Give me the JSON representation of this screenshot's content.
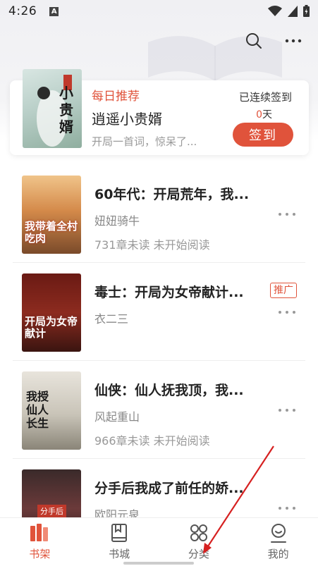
{
  "status_bar": {
    "time": "4:26",
    "notification_letter": "A"
  },
  "header": {
    "search_icon": "search-icon",
    "more_icon": "more-horizontal-icon"
  },
  "recommend": {
    "tag": "每日推荐",
    "title": "逍遥小贵婿",
    "desc": "开局一首词，惊呆了...",
    "sign_label": "已连续签到",
    "sign_days": "0",
    "sign_days_unit": "天",
    "sign_button": "签到",
    "cover_text": "小贵婿"
  },
  "books": [
    {
      "title": "60年代：开局荒年，我...",
      "author": "妞妞骑牛",
      "status": "731章未读 未开始阅读",
      "cover_text": "我带着全村吃肉",
      "ad": ""
    },
    {
      "title": "毒士：开局为女帝献计...",
      "author": "衣二三",
      "status": "",
      "cover_text": "开局为女帝献计",
      "ad": "推广"
    },
    {
      "title": "仙侠：仙人抚我顶，我...",
      "author": "风起重山",
      "status": "966章未读 未开始阅读",
      "cover_text": "我授仙人长生",
      "ad": ""
    },
    {
      "title": "分手后我成了前任的娇...",
      "author": "欧阳元泉",
      "status": "",
      "cover_text": "分手后",
      "ad": ""
    }
  ],
  "nav": [
    {
      "label": "书架",
      "icon": "bookshelf-icon",
      "active": true
    },
    {
      "label": "书城",
      "icon": "book-icon",
      "active": false
    },
    {
      "label": "分类",
      "icon": "category-icon",
      "active": false
    },
    {
      "label": "我的",
      "icon": "profile-icon",
      "active": false
    }
  ],
  "colors": {
    "accent": "#e0533b",
    "annotation_arrow": "#d62020"
  }
}
